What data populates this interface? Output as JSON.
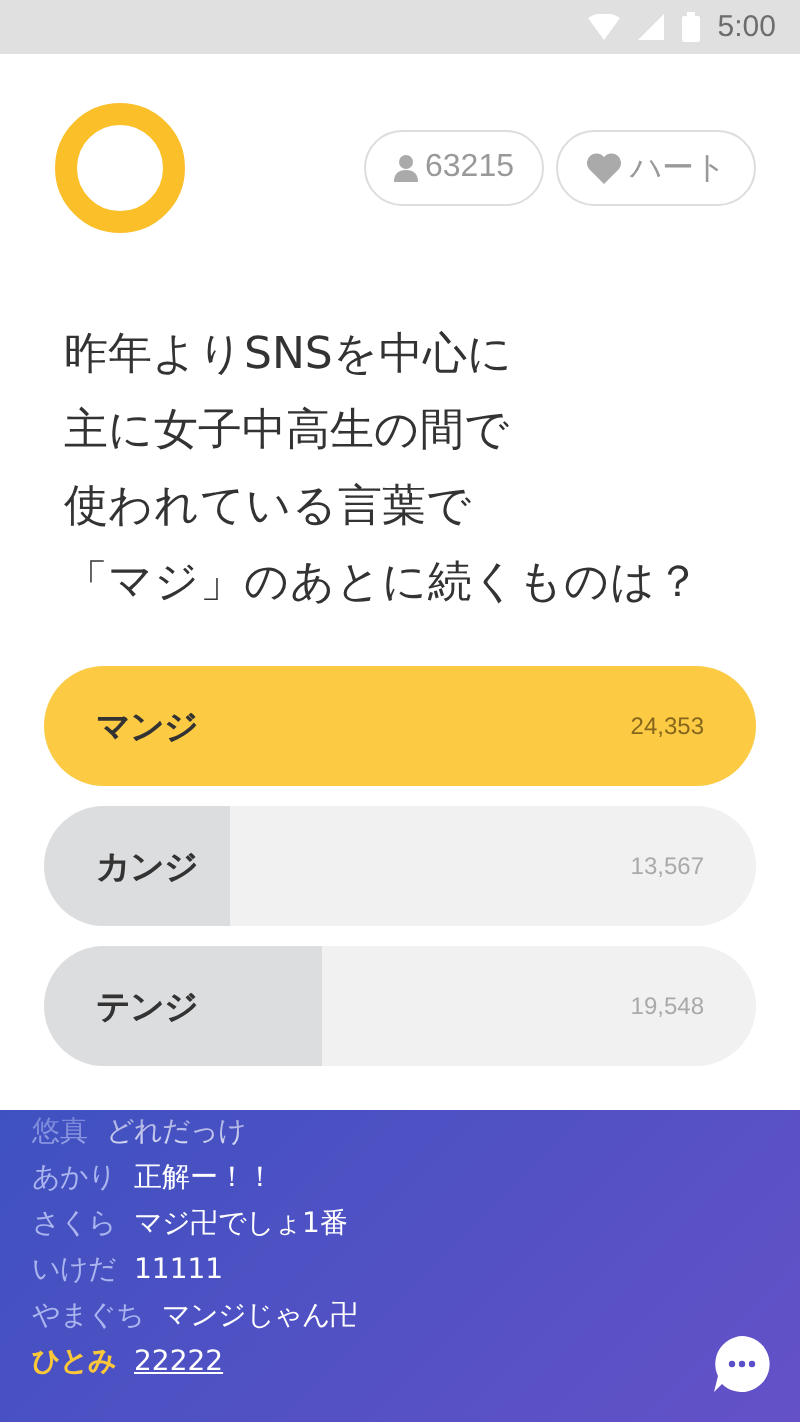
{
  "status_bar": {
    "time": "5:00"
  },
  "header": {
    "players": "63215",
    "heart_label": "ハート"
  },
  "question": {
    "lines": [
      "昨年よりSNSを中心に",
      "主に女子中高生の間で",
      "使われている言葉で",
      "「マジ」のあとに続くものは？"
    ]
  },
  "answers": [
    {
      "label": "マンジ",
      "count": "24,353",
      "selected": true,
      "level": 1
    },
    {
      "label": "カンジ",
      "count": "13,567",
      "selected": false,
      "level": 0.26
    },
    {
      "label": "テンジ",
      "count": "19,548",
      "selected": false,
      "level": 0.39
    }
  ],
  "chat": [
    {
      "name": "悠真",
      "message": "どれだっけ",
      "highlighted": false
    },
    {
      "name": "あかり",
      "message": "正解ー！！",
      "highlighted": false
    },
    {
      "name": "さくら",
      "message": "マジ卍でしょ1番",
      "highlighted": false
    },
    {
      "name": "いけだ",
      "message": "11111",
      "highlighted": false
    },
    {
      "name": "やまぐち",
      "message": "マンジじゃん卍",
      "highlighted": false
    },
    {
      "name": "ひとみ",
      "message": "22222",
      "highlighted": true
    }
  ]
}
